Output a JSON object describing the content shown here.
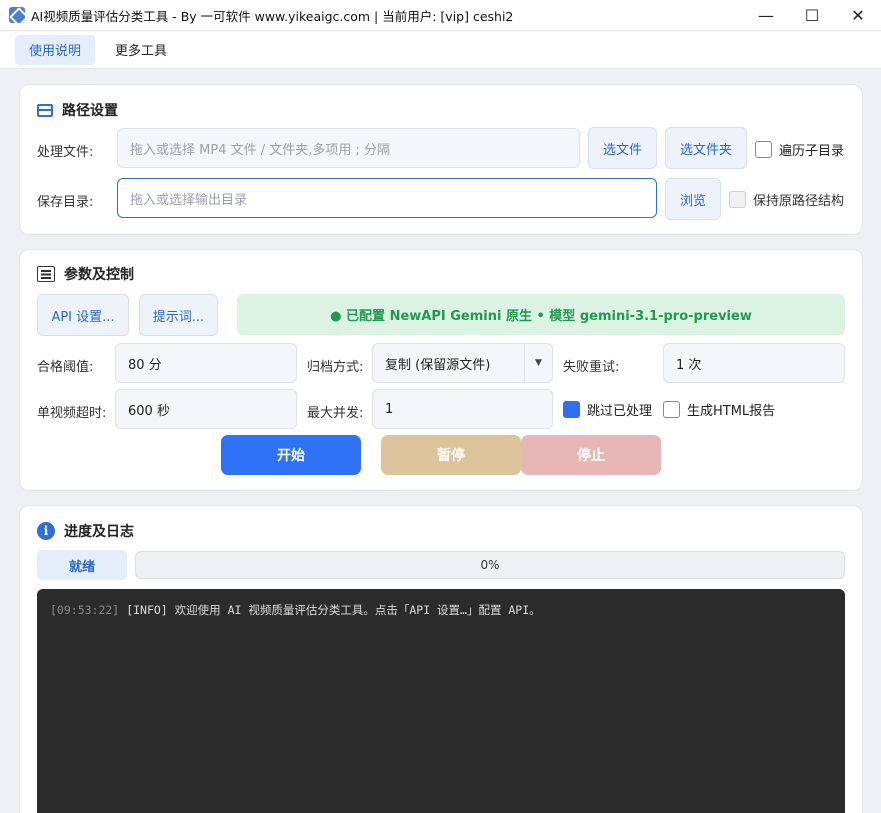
{
  "window": {
    "title": "AI视频质量评估分类工具 - By 一可软件 www.yikeaigc.com    |   当前用户: [vip] ceshi2",
    "controls": {
      "minimize": "—",
      "maximize": "☐",
      "close": "✕"
    }
  },
  "menu": {
    "items": [
      {
        "label": "使用说明",
        "active": true
      },
      {
        "label": "更多工具",
        "active": false
      }
    ]
  },
  "path_settings": {
    "title": "路径设置",
    "process_file": {
      "label": "处理文件:",
      "placeholder": "拖入或选择 MP4 文件 / 文件夹,多项用 ; 分隔",
      "btn_file": "选文件",
      "btn_folder": "选文件夹",
      "recurse_label": "遍历子目录",
      "recurse_checked": false
    },
    "save_dir": {
      "label": "保存目录:",
      "placeholder": "拖入或选择输出目录",
      "btn_browse": "浏览",
      "keep_structure_label": "保持原路径结构",
      "keep_structure_checked": false
    }
  },
  "params": {
    "title": "参数及控制",
    "btn_api": "API 设置...",
    "btn_prompt": "提示词...",
    "status_banner": "● 已配置  NewAPI Gemini 原生 • 模型 gemini-3.1-pro-preview",
    "threshold": {
      "label": "合格阈值:",
      "value": "80 分"
    },
    "archive": {
      "label": "归档方式:",
      "value": "复制 (保留源文件)"
    },
    "retry": {
      "label": "失败重试:",
      "value": "1 次"
    },
    "timeout": {
      "label": "单视频超时:",
      "value": "600 秒"
    },
    "concurrency": {
      "label": "最大并发:",
      "value": "1"
    },
    "skip_processed": {
      "label": "跳过已处理",
      "checked": true
    },
    "html_report": {
      "label": "生成HTML报告",
      "checked": false
    },
    "btn_start": "开始",
    "btn_pause": "暂停",
    "btn_stop": "停止",
    "colors": {
      "start": "#2f72f5",
      "pause": "#dcc59c",
      "stop": "#e7b7b8"
    }
  },
  "progress": {
    "title": "进度及日志",
    "status": "就绪",
    "percent_text": "0%",
    "percent": 0,
    "log": [
      {
        "time": "[09:53:22]",
        "text": "[INFO] 欢迎使用 AI 视频质量评估分类工具。点击「API 设置…」配置 API。"
      }
    ]
  }
}
